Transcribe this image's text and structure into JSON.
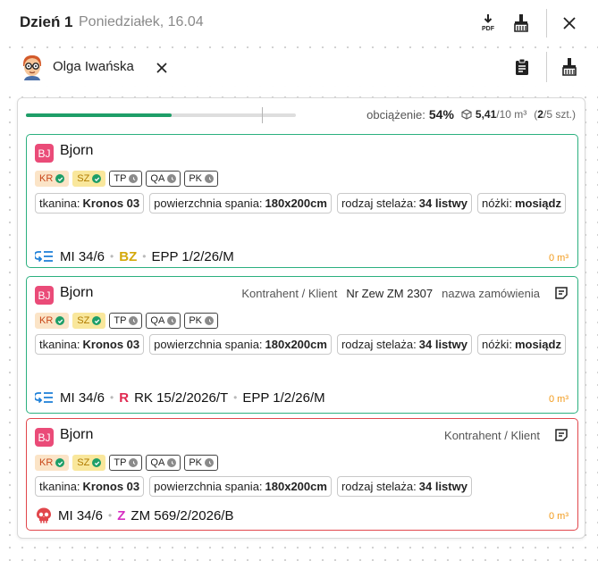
{
  "header": {
    "day": "Dzień 1",
    "date": "Poniedziałek, 16.04",
    "pdf_label": "PDF"
  },
  "user": {
    "name": "Olga Iwańska"
  },
  "load": {
    "progress_fraction": 0.54,
    "label": "obciążenie:",
    "percent": "54%",
    "volume_value": "5,41",
    "volume_total": "/10 m³",
    "count_open": "(",
    "count_value": "2",
    "count_rest": "/5 szt.)"
  },
  "cards": [
    {
      "avatar": "BJ",
      "name": "Bjorn",
      "contractor": "",
      "nr_zew": "",
      "order_name": "",
      "badges": [
        "KR",
        "SZ",
        "TP",
        "QA",
        "PK"
      ],
      "params": [
        {
          "label": "tkanina:",
          "value": "Kronos 03"
        },
        {
          "label": "powierzchnia spania:",
          "value": "180x200cm"
        },
        {
          "label": "rodzaj stelaża:",
          "value": "34 listwy"
        },
        {
          "label": "nóżki:",
          "value": "mosiądz"
        }
      ],
      "footer": {
        "code": "MI 34/6",
        "letter": "BZ",
        "letter_color": "#d4a80a",
        "ref": "",
        "epp": "EPP 1/2/26/M"
      },
      "volume": "0 m³",
      "status_color": "#2bb07f"
    },
    {
      "avatar": "BJ",
      "name": "Bjorn",
      "contractor": "Kontrahent / Klient",
      "nr_zew": "Nr Zew ZM 2307",
      "order_name": "nazwa zamówienia",
      "badges": [
        "KR",
        "SZ",
        "TP",
        "QA",
        "PK"
      ],
      "params": [
        {
          "label": "tkanina:",
          "value": "Kronos 03"
        },
        {
          "label": "powierzchnia spania:",
          "value": "180x200cm"
        },
        {
          "label": "rodzaj stelaża:",
          "value": "34 listwy"
        },
        {
          "label": "nóżki:",
          "value": "mosiądz"
        }
      ],
      "footer": {
        "code": "MI 34/6",
        "letter": "R",
        "letter_color": "#e02950",
        "ref": "RK 15/2/2026/T",
        "epp": "EPP 1/2/26/M"
      },
      "volume": "0 m³",
      "status_color": "#2bb07f"
    },
    {
      "avatar": "BJ",
      "name": "Bjorn",
      "contractor": "Kontrahent / Klient",
      "nr_zew": "",
      "order_name": "",
      "badges": [
        "KR",
        "SZ",
        "TP",
        "QA",
        "PK"
      ],
      "params": [
        {
          "label": "tkanina:",
          "value": "Kronos 03"
        },
        {
          "label": "powierzchnia spania:",
          "value": "180x200cm"
        },
        {
          "label": "rodzaj stelaża:",
          "value": "34 listwy"
        }
      ],
      "footer": {
        "code": "MI 34/6",
        "letter": "Z",
        "letter_color": "#d62fc2",
        "ref": "ZM 569/2/2026/B",
        "epp": ""
      },
      "volume": "0 m³",
      "status_color": "#e1464b"
    }
  ]
}
